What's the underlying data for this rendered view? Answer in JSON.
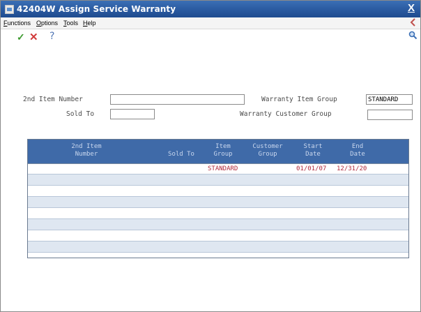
{
  "window": {
    "title": "42404W  Assign Service Warranty",
    "close_label": "X"
  },
  "menu": [
    "Functions",
    "Options",
    "Tools",
    "Help"
  ],
  "toolbar": {
    "ok_glyph": "✓",
    "cancel_glyph": "✕",
    "help_glyph": "?"
  },
  "form": {
    "item_number_label": "2nd Item Number",
    "item_number_value": "",
    "sold_to_label": "Sold To",
    "sold_to_value": "",
    "warranty_item_group_label": "Warranty Item Group",
    "warranty_item_group_value": "STANDARD",
    "warranty_customer_group_label": "Warranty Customer Group",
    "warranty_customer_group_value": ""
  },
  "grid": {
    "columns": [
      [
        "2nd Item",
        "Number"
      ],
      [
        "",
        "Sold To"
      ],
      [
        "Item",
        "Group"
      ],
      [
        "Customer",
        "Group"
      ],
      [
        "Start",
        "Date"
      ],
      [
        "End",
        "Date"
      ]
    ],
    "rows": [
      [
        "",
        "",
        "STANDARD",
        "",
        "01/01/07",
        "12/31/20"
      ],
      [
        "",
        "",
        "",
        "",
        "",
        ""
      ],
      [
        "",
        "",
        "",
        "",
        "",
        ""
      ],
      [
        "",
        "",
        "",
        "",
        "",
        ""
      ],
      [
        "",
        "",
        "",
        "",
        "",
        ""
      ],
      [
        "",
        "",
        "",
        "",
        "",
        ""
      ],
      [
        "",
        "",
        "",
        "",
        "",
        ""
      ],
      [
        "",
        "",
        "",
        "",
        "",
        ""
      ]
    ]
  }
}
